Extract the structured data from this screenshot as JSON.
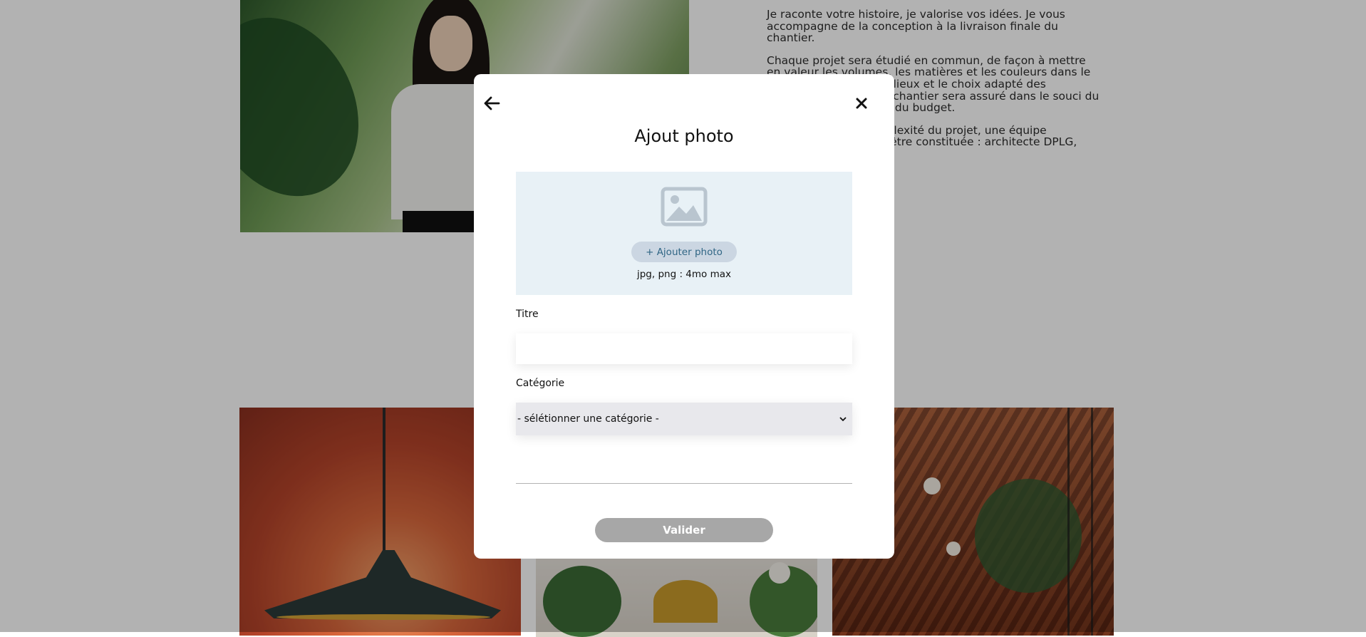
{
  "about": {
    "paragraph_1": "Je raconte votre histoire, je valorise vos idées. Je vous accompagne de la conception à la livraison finale du chantier.",
    "paragraph_2": "Chaque projet sera étudié en commun, de façon à mettre en valeur les volumes, les matières et les couleurs dans le respect de l’esprit des lieux et le choix adapté des matériaux. Le suivi du chantier sera assuré dans le souci du respect du planning et du budget.",
    "paragraph_3": "En fonction de la complexité du projet, une équipe pluridisciplinaire peut-être constituée : architecte DPLG, décorateur(trice)."
  },
  "modal": {
    "title": "Ajout photo",
    "upload_button": "+ Ajouter photo",
    "upload_hint": "jpg, png : 4mo max",
    "titre_label": "Titre",
    "titre_value": "",
    "categorie_label": "Catégorie",
    "categorie_selected": "- sélétionner une catégorie -",
    "submit_label": "Valider"
  },
  "icons": {
    "back": "arrow-left-icon",
    "close": "close-icon",
    "image": "image-placeholder-icon",
    "chevron": "chevron-down-icon"
  },
  "colors": {
    "overlay": "rgba(0,0,0,0.30)",
    "upload_zone_bg": "#e8f1f6",
    "upload_button_bg": "#cbd6e2",
    "upload_button_text": "#306685",
    "select_bg": "#e8e8ec",
    "submit_disabled_bg": "#a7a7a7"
  }
}
